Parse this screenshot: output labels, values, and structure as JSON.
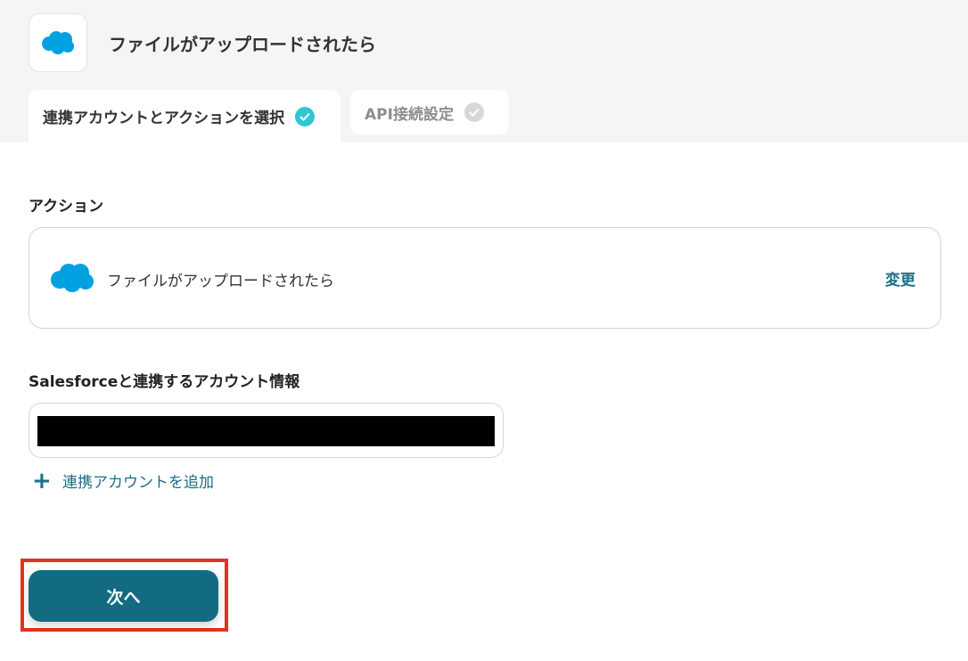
{
  "header": {
    "title": "ファイルがアップロードされたら",
    "app_icon": "salesforce-cloud-icon"
  },
  "tabs": [
    {
      "label": "連携アカウントとアクションを選択",
      "state": "completed"
    },
    {
      "label": "API接続設定",
      "state": "pending"
    }
  ],
  "action_section": {
    "label": "アクション",
    "action_name": "ファイルがアップロードされたら",
    "change_label": "変更"
  },
  "account_section": {
    "label": "Salesforceと連携するアカウント情報",
    "account_value": "[redacted]",
    "add_account_label": "連携アカウントを追加"
  },
  "footer": {
    "next_label": "次へ"
  },
  "colors": {
    "accent": "#136b82",
    "link": "#1a6f86",
    "check_active": "#2fc6d4",
    "salesforce_blue": "#00a1e0",
    "highlight": "#e5321c"
  }
}
